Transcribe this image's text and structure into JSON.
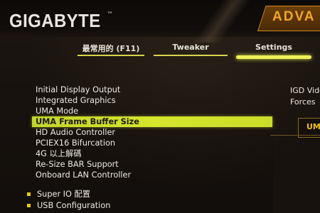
{
  "header": {
    "logo": "GIGABYTE",
    "trademark": "™",
    "active_section": "ADVA"
  },
  "nav": {
    "tabs": [
      {
        "label": "最常用的 (F11)",
        "active": false
      },
      {
        "label": "Tweaker",
        "active": false
      },
      {
        "label": "Settings",
        "active": true
      }
    ]
  },
  "menu": {
    "items": [
      {
        "label": "Initial Display Output"
      },
      {
        "label": "Integrated Graphics"
      },
      {
        "label": "UMA Mode"
      },
      {
        "label": "UMA Frame Buffer Size",
        "selected": true
      },
      {
        "label": "HD Audio Controller"
      },
      {
        "label": "PCIEX16 Bifurcation"
      },
      {
        "label": "4G 以上解碼"
      },
      {
        "label": "Re-Size BAR Support"
      },
      {
        "label": "Onboard LAN Controller"
      }
    ],
    "submenus": [
      {
        "label": "Super IO 配置"
      },
      {
        "label": "USB Configuration"
      }
    ]
  },
  "help_panel": {
    "line1": "IGD Vide",
    "line2": "Forces",
    "option_label": "UMA"
  },
  "colors": {
    "highlight": "#d2e22c",
    "accent": "#f3a52a",
    "bullet": "#e9c51a"
  }
}
